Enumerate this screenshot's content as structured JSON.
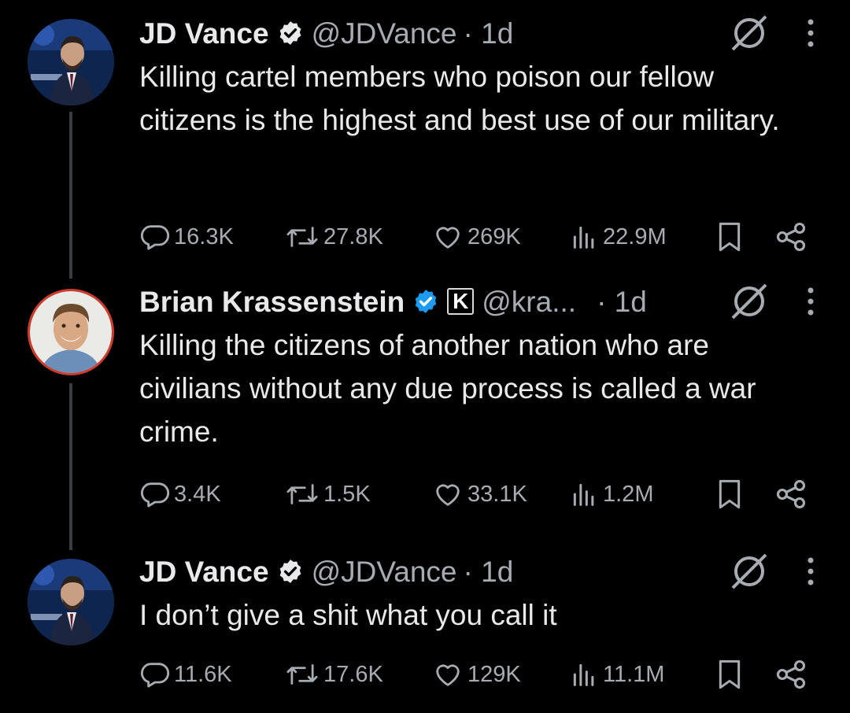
{
  "tweets": [
    {
      "name": "JD Vance",
      "handle": "@JDVance",
      "time": "· 1d",
      "text": "Killing cartel members who poison our fellow citizens is the highest and best use of our military.",
      "replies": "16.3K",
      "reposts": "27.8K",
      "likes": "269K",
      "views": "22.9M"
    },
    {
      "name": "Brian Krassenstein",
      "affiliate_badge": "K",
      "handle": "@kra...",
      "time": "· 1d",
      "text": "Killing the citizens of another nation who are civilians without any due process is called a war crime.",
      "replies": "3.4K",
      "reposts": "1.5K",
      "likes": "33.1K",
      "views": "1.2M"
    },
    {
      "name": "JD Vance",
      "handle": "@JDVance",
      "time": "· 1d",
      "text": "I don’t give a shit what you call it",
      "replies": "11.6K",
      "reposts": "17.6K",
      "likes": "129K",
      "views": "11.1M"
    }
  ],
  "icons": {
    "verified": "verified-badge-icon",
    "grok": "grok-icon",
    "more": "more-icon",
    "reply": "reply-icon",
    "repost": "repost-icon",
    "like": "like-icon",
    "views": "views-icon",
    "bookmark": "bookmark-icon",
    "share": "share-icon"
  },
  "colors": {
    "background": "#000000",
    "text": "#e7e9ea",
    "secondary": "#a6acb2",
    "verified_blue": "#1d9bf0",
    "thread_line": "#3a3d41"
  }
}
